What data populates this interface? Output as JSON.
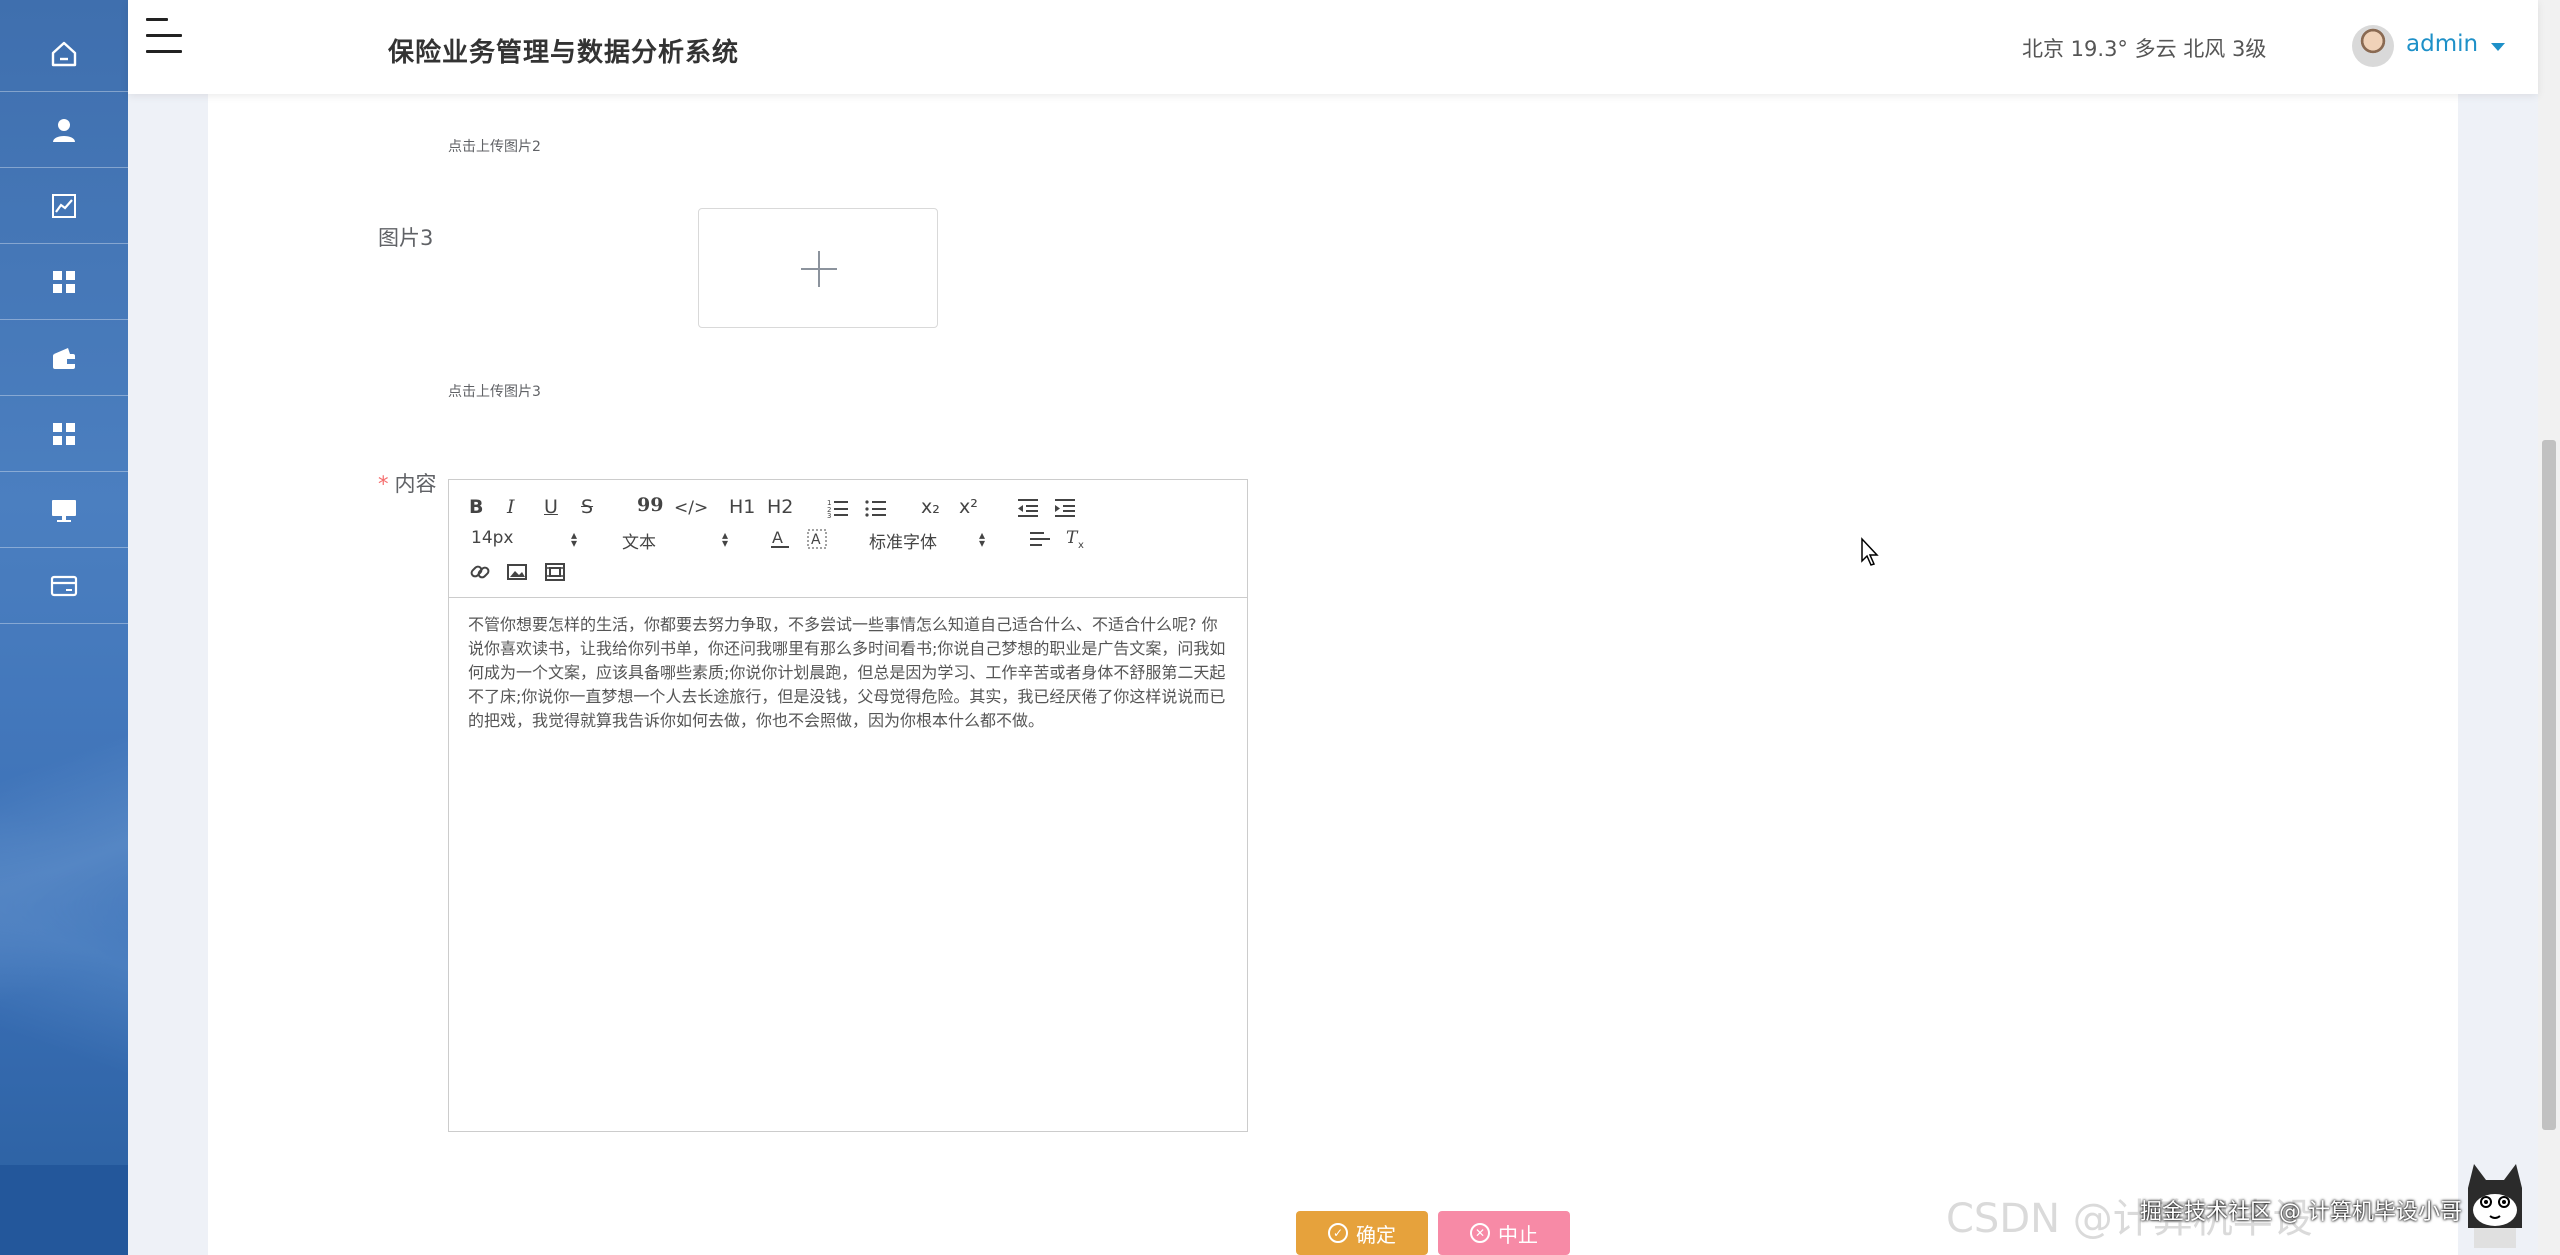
{
  "header": {
    "app_title": "保险业务管理与数据分析系统",
    "weather": "北京  19.3°  多云  北风  3级",
    "username": "admin"
  },
  "sidebar": {
    "items": [
      {
        "icon": "home-icon"
      },
      {
        "icon": "user-icon"
      },
      {
        "icon": "chart-icon"
      },
      {
        "icon": "grid-icon"
      },
      {
        "icon": "wallet-icon"
      },
      {
        "icon": "grid-icon"
      },
      {
        "icon": "monitor-icon"
      },
      {
        "icon": "card-icon"
      }
    ]
  },
  "form": {
    "upload2_hint": "点击上传图片2",
    "image3_label": "图片3",
    "upload3_hint": "点击上传图片3",
    "content_required": "*",
    "content_label": "内容"
  },
  "editor": {
    "toolbar": {
      "bold": "B",
      "italic": "I",
      "underline": "U",
      "strike": "S",
      "blockquote": "99",
      "code": "</>",
      "h1": "H1",
      "h2": "H2",
      "sub": "x₂",
      "sup": "x²",
      "size": "14px",
      "header": "文本",
      "font": "标准字体"
    },
    "content": "不管你想要怎样的生活，你都要去努力争取，不多尝试一些事情怎么知道自己适合什么、不适合什么呢? 你说你喜欢读书，让我给你列书单，你还问我哪里有那么多时间看书;你说自己梦想的职业是广告文案，问我如何成为一个文案，应该具备哪些素质;你说你计划晨跑，但总是因为学习、工作辛苦或者身体不舒服第二天起不了床;你说你一直梦想一个人去长途旅行，但是没钱，父母觉得危险。其实，我已经厌倦了你这样说说而已的把戏，我觉得就算我告诉你如何去做，你也不会照做，因为你根本什么都不做。"
  },
  "buttons": {
    "confirm": "确定",
    "cancel": "中止"
  },
  "watermark": {
    "csdn": "CSDN @计算机毕设",
    "juejin": "掘金技术社区 @ 计算机毕设小哥"
  },
  "colors": {
    "sidebar": "#4b7fc0",
    "accent": "#1e90c8",
    "confirm": "#e6a23c",
    "cancel": "#f78aa6",
    "required": "#f56c6c"
  }
}
